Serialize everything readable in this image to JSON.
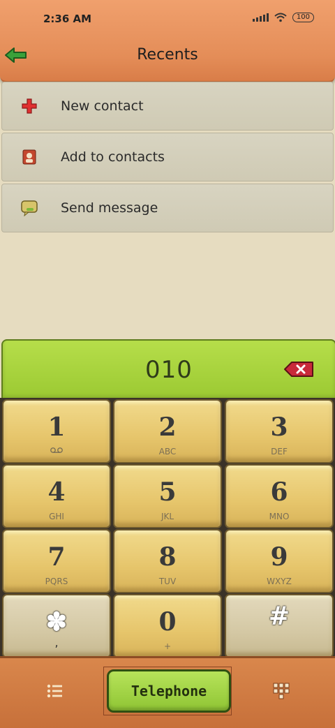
{
  "status": {
    "time": "2:36 AM",
    "battery": "100"
  },
  "header": {
    "title": "Recents"
  },
  "menu": [
    {
      "label": "New contact",
      "icon": "plus-icon"
    },
    {
      "label": "Add to contacts",
      "icon": "contact-card-icon"
    },
    {
      "label": "Send message",
      "icon": "message-icon"
    }
  ],
  "dialer": {
    "number": "010"
  },
  "keys": [
    {
      "digit": "1",
      "letters": ""
    },
    {
      "digit": "2",
      "letters": "ABC"
    },
    {
      "digit": "3",
      "letters": "DEF"
    },
    {
      "digit": "4",
      "letters": "GHI"
    },
    {
      "digit": "5",
      "letters": "JKL"
    },
    {
      "digit": "6",
      "letters": "MNO"
    },
    {
      "digit": "7",
      "letters": "PQRS"
    },
    {
      "digit": "8",
      "letters": "TUV"
    },
    {
      "digit": "9",
      "letters": "WXYZ"
    },
    {
      "digit": "✽",
      "letters": ","
    },
    {
      "digit": "0",
      "letters": "+"
    },
    {
      "digit": "#",
      "letters": ""
    }
  ],
  "bottom": {
    "telephone_label": "Telephone"
  },
  "colors": {
    "header": "#e48d58",
    "display": "#a8d23c",
    "key": "#e6c56b",
    "bottom": "#c7703a"
  }
}
